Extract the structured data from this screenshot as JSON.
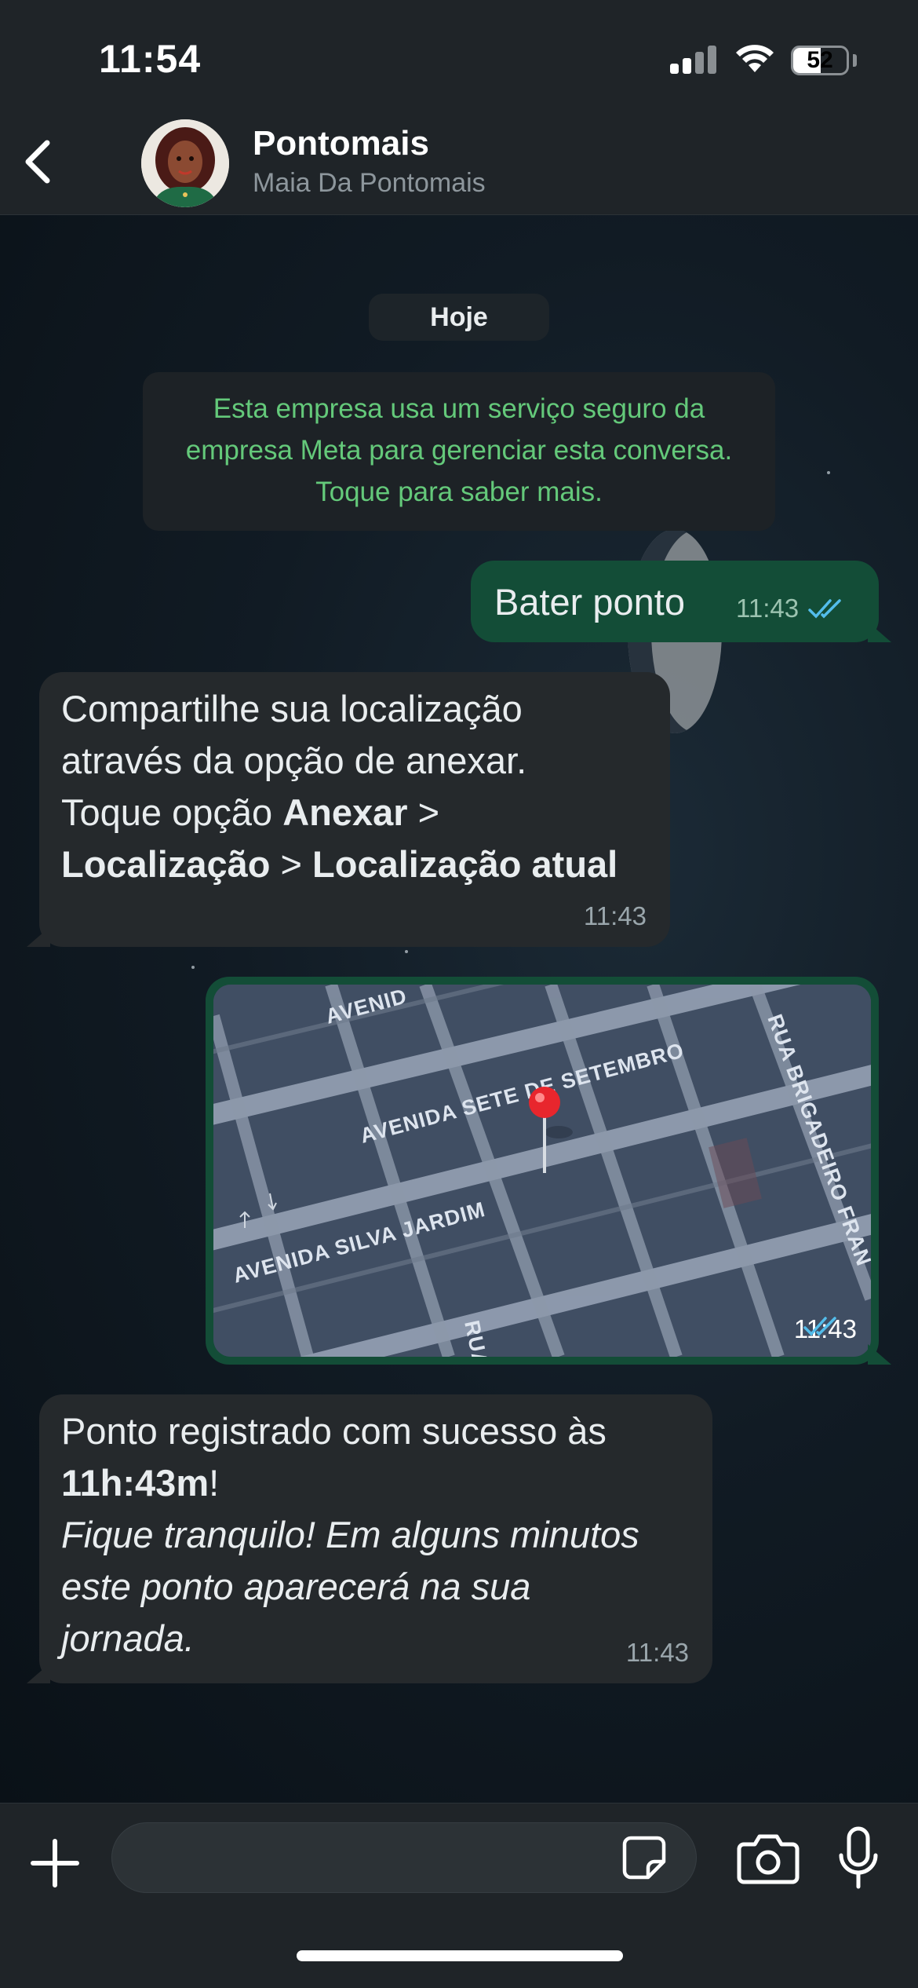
{
  "status_bar": {
    "time": "11:54",
    "battery": "52",
    "battery_level_percent": 52
  },
  "header": {
    "contact_name": "Pontomais",
    "contact_subtitle": "Maia Da Pontomais",
    "back_icon": "chevron-left-icon",
    "avatar_icon": "avatar"
  },
  "chat": {
    "date_chip": "Hoje",
    "system_note": "Esta empresa usa um serviço seguro da empresa Meta para gerenciar esta conversa. Toque para saber mais.",
    "messages": [
      {
        "direction": "outgoing",
        "text": "Bater ponto",
        "time": "11:43",
        "status": "read"
      },
      {
        "direction": "incoming",
        "lines": {
          "l1": "Compartilhe sua localização",
          "l2": "através da opção de anexar.",
          "l3_prefix": "Toque opção ",
          "l3_bold": "Anexar",
          "l3_suffix": " >",
          "l4_bold_a": "Localização",
          "l4_sep": " > ",
          "l4_bold_b": "Localização atual"
        },
        "time": "11:43"
      },
      {
        "direction": "outgoing",
        "type": "location",
        "streets": {
          "s1": "AVENIDA SETE DE SETEMBRO",
          "s2": "AVENIDA SILVA JARDIM",
          "s3": "RUA BRIGADEIRO FRAN",
          "s4": "AVENID",
          "s5": "RUA"
        },
        "time": "11:43",
        "status": "read"
      },
      {
        "direction": "incoming",
        "lines": {
          "l1": "Ponto registrado com sucesso às",
          "l2_bold": "11h:43m",
          "l2_suffix": "!",
          "l3_italic": "Fique tranquilo! Em alguns minutos",
          "l4_italic": "este ponto aparecerá na sua",
          "l5_italic": "jornada."
        },
        "time": "11:43"
      }
    ]
  },
  "input_bar": {
    "placeholder": "",
    "icons": [
      "plus-icon",
      "sticker-icon",
      "camera-icon",
      "microphone-icon"
    ]
  },
  "colors": {
    "outgoing_bubble": "#134d37",
    "incoming_bubble": "#25292c",
    "system_note_text": "#64c97a",
    "read_ticks": "#53bdeb"
  }
}
